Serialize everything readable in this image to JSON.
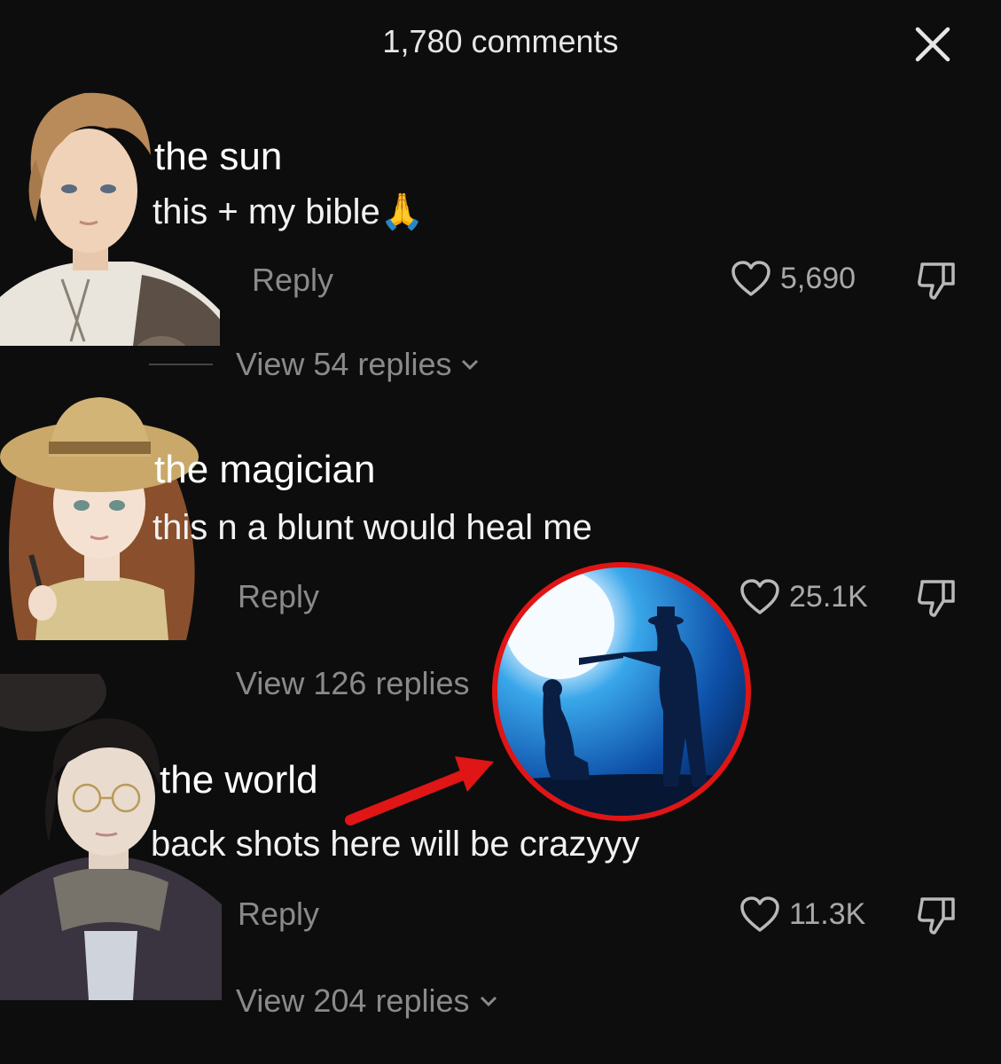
{
  "header": {
    "title": "1,780 comments"
  },
  "icons": {
    "close": "close-icon",
    "like": "heart-icon",
    "dislike": "thumbs-down-icon",
    "chevron": "chevron-down-icon"
  },
  "colors": {
    "background": "#0d0d0d",
    "muted": "#8a8a8a",
    "highlight_ring": "#e01515",
    "arrow": "#e01515"
  },
  "comments": [
    {
      "username": "the sun",
      "text": "this + my bible",
      "emoji": "🙏",
      "reply_label": "Reply",
      "likes": "5,690",
      "view_replies": "View 54 replies"
    },
    {
      "username": "the magician",
      "text": "this n a blunt would heal me",
      "reply_label": "Reply",
      "likes": "25.1K",
      "view_replies": "View 126 replies"
    },
    {
      "username": "the world",
      "text": "back shots here will be crazyyy",
      "reply_label": "Reply",
      "likes": "11.3K",
      "view_replies": "View 204 replies"
    }
  ]
}
